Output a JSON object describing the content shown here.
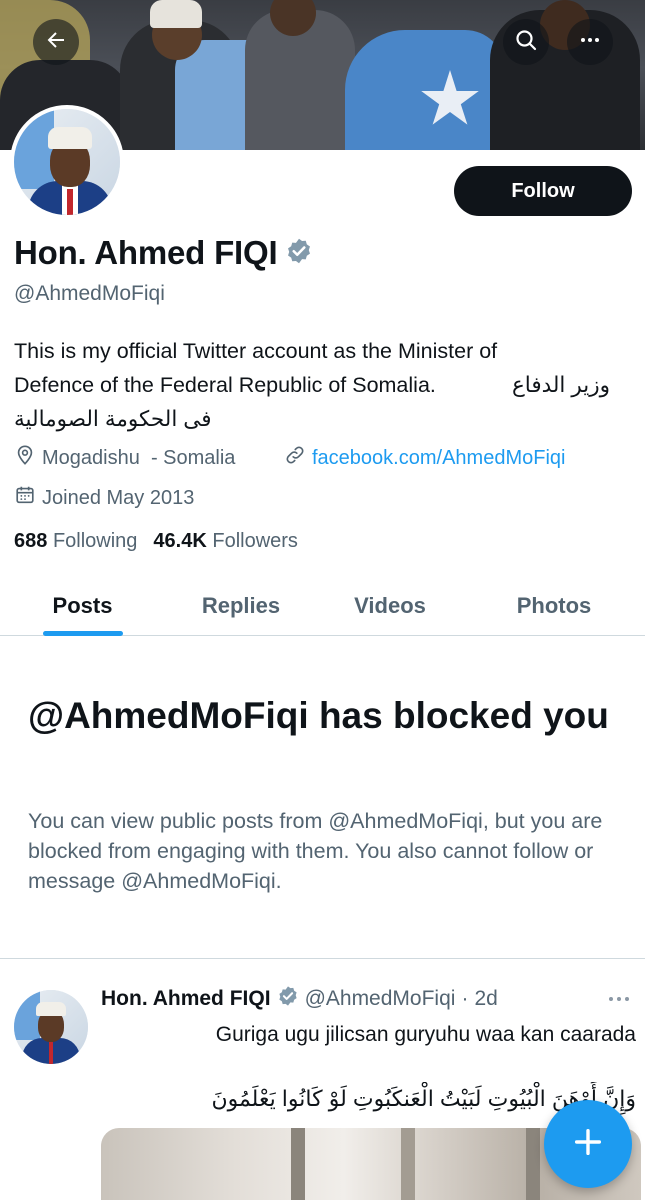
{
  "profile": {
    "display_name": "Hon. Ahmed FIQI",
    "handle": "@AhmedMoFiqi",
    "follow_label": "Follow",
    "bio_line1": "This is my official Twitter account as the Minister of",
    "bio_line2_en": "Defence of the Federal Republic of Somalia.",
    "bio_line2_ar": "وزير الدفاع",
    "bio_line3_ar": "فى الحكومة الصومالية",
    "location": "Mogadishu  - Somalia",
    "website": "facebook.com/AhmedMoFiqi",
    "joined": "Joined May 2013",
    "following_count": "688",
    "following_label": "Following",
    "followers_count": "46.4K",
    "followers_label": "Followers"
  },
  "tabs": [
    {
      "label": "Posts",
      "active": true
    },
    {
      "label": "Replies",
      "active": false
    },
    {
      "label": "Videos",
      "active": false
    },
    {
      "label": "Photos",
      "active": false
    }
  ],
  "blocked": {
    "title": "@AhmedMoFiqi has blocked you",
    "message": "You can view public posts from @AhmedMoFiqi, but you are blocked from engaging with them. You also cannot follow or message @AhmedMoFiqi."
  },
  "post": {
    "name": "Hon. Ahmed FIQI",
    "handle": "@AhmedMoFiqi",
    "separator": "·",
    "time": "2d",
    "text": "Guriga ugu jilicsan guryuhu waa kan caarada",
    "arabic": "وَإِنَّ أَوْهَنَ الْبُيُوتِ لَبَيْتُ الْعَنكَبُوتِ لَوْ كَانُوا يَعْلَمُونَ"
  },
  "icons": {
    "back": "arrow-left-icon",
    "search": "search-icon",
    "more": "more-icon",
    "verified": "verified-badge-icon",
    "location": "location-pin-icon",
    "link": "link-icon",
    "calendar": "calendar-icon",
    "compose": "plus-icon"
  },
  "colors": {
    "accent": "#1d9bf0",
    "text_primary": "#0f1419",
    "text_secondary": "#536471",
    "verified": "#829aab"
  }
}
